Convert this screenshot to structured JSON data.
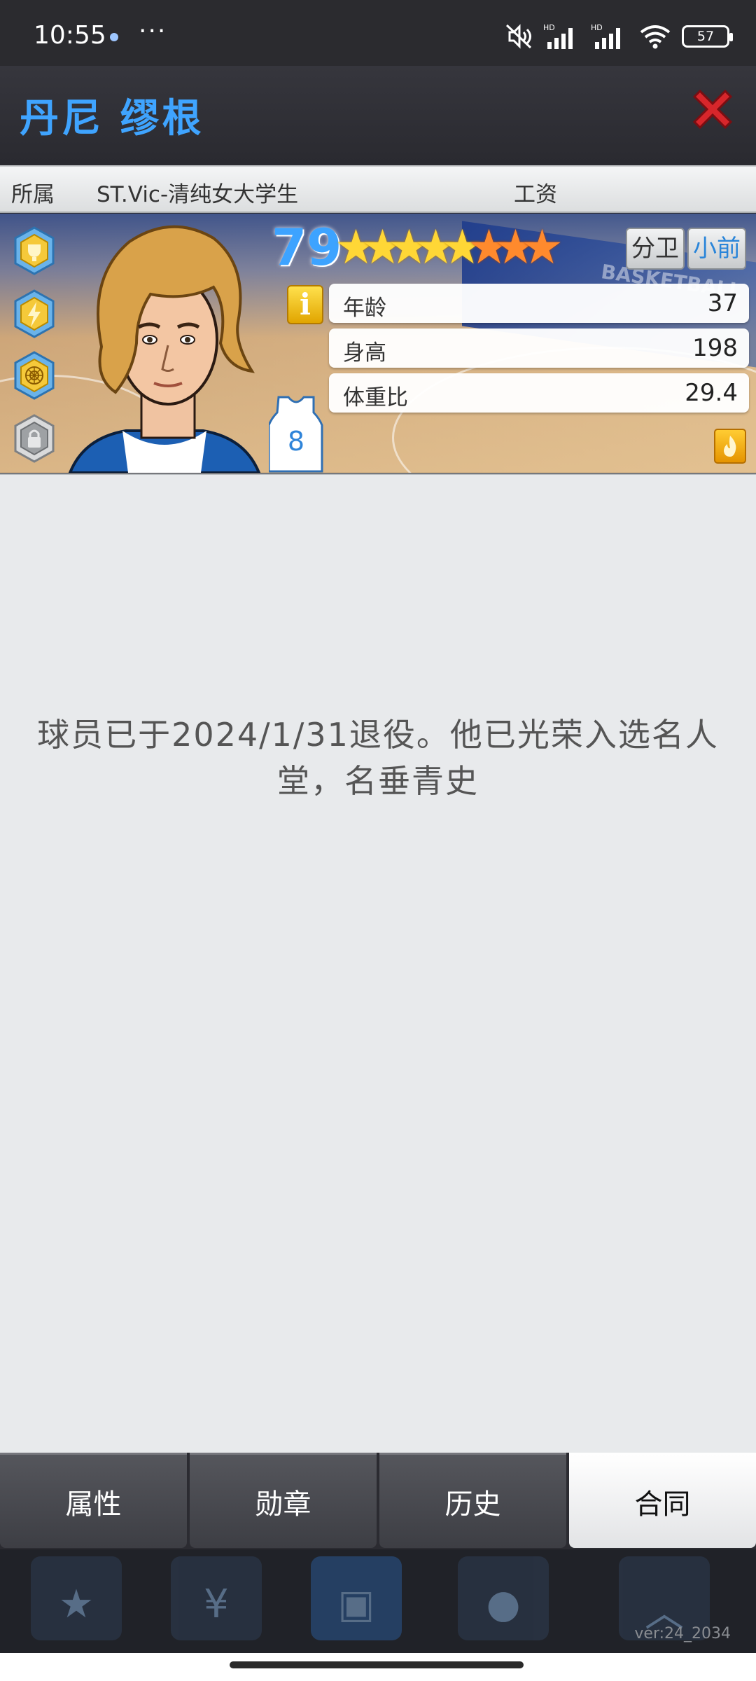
{
  "status_bar": {
    "time": "10:55",
    "more": "···",
    "battery": "57",
    "icons": [
      "mute-icon",
      "signal-hd-icon",
      "signal-hd-icon",
      "wifi-icon",
      "battery-icon"
    ]
  },
  "header": {
    "player_name": "丹尼 缪根",
    "close_icon": "close-icon",
    "close_color": "#d7262b",
    "name_color": "#3fa4ff"
  },
  "info_strip": {
    "affiliation_label": "所属",
    "affiliation_value": "ST.Vic-清纯女大学生",
    "salary_label": "工资"
  },
  "card": {
    "overall": "79",
    "stars_gold": 5,
    "stars_orange": 3,
    "positions": [
      "分卫",
      "小前"
    ],
    "info_label": "i",
    "jersey_number": "8",
    "banner_text": "BASKETBALL",
    "stats": [
      {
        "label": "年龄",
        "value": "37"
      },
      {
        "label": "身高",
        "value": "198"
      },
      {
        "label": "体重比",
        "value": "29.4"
      }
    ],
    "badges": [
      "trophy-badge-icon",
      "lightning-badge-icon",
      "web-badge-icon",
      "lock-icon"
    ]
  },
  "main": {
    "message": "球员已于2024/1/31退役。他已光荣入选名人堂，名垂青史"
  },
  "tabs": [
    {
      "label": "属性",
      "active": false
    },
    {
      "label": "勋章",
      "active": false
    },
    {
      "label": "历史",
      "active": false
    },
    {
      "label": "合同",
      "active": true
    }
  ],
  "dock": {
    "version": "ver:24_2034",
    "icons": [
      "star-icon",
      "yen-icon",
      "gym-icon",
      "ball-icon",
      "chevron-up-icon"
    ]
  }
}
